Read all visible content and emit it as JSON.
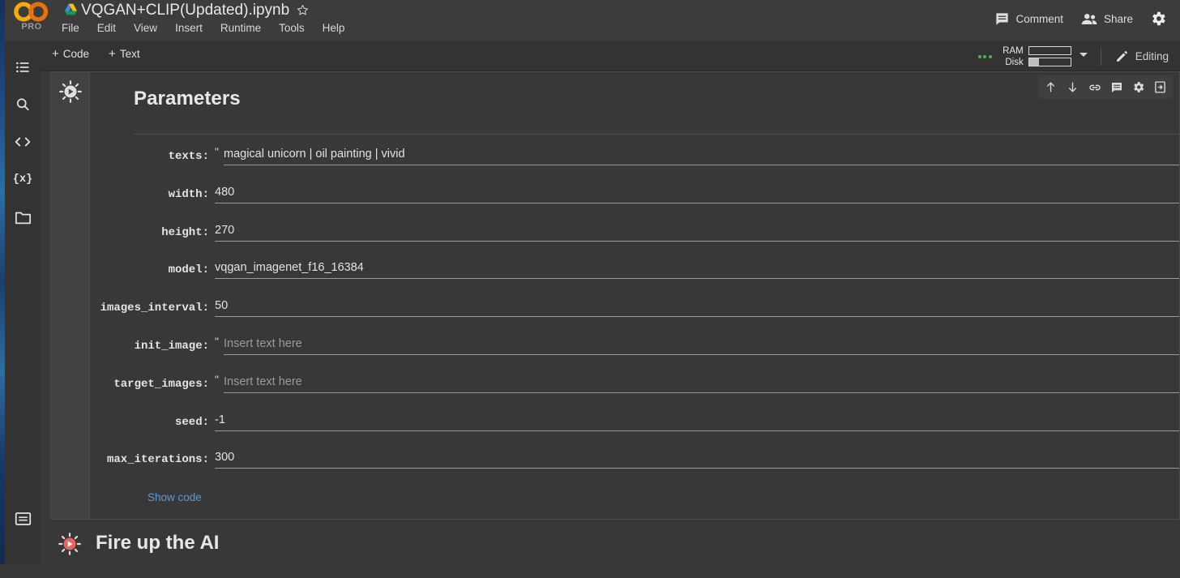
{
  "app": {
    "logo_text": "CO",
    "pro_badge": "PRO",
    "doc_title": "VQGAN+CLIP(Updated).ipynb"
  },
  "menubar": {
    "items": [
      {
        "label": "File"
      },
      {
        "label": "Edit"
      },
      {
        "label": "View"
      },
      {
        "label": "Insert"
      },
      {
        "label": "Runtime"
      },
      {
        "label": "Tools"
      },
      {
        "label": "Help"
      }
    ],
    "comment_label": "Comment",
    "share_label": "Share"
  },
  "toolbar": {
    "add_code_label": "Code",
    "add_text_label": "Text",
    "plus_sign": "+",
    "ram_label": "RAM",
    "disk_label": "Disk",
    "ram_fill_percent": 0,
    "disk_fill_percent": 25,
    "editing_label": "Editing"
  },
  "sidebar": {
    "items": [
      {
        "name": "table-of-contents",
        "icon": "list-icon"
      },
      {
        "name": "find-and-replace",
        "icon": "search-icon"
      },
      {
        "name": "code-snippets",
        "icon": "code-brackets-icon"
      },
      {
        "name": "variables",
        "icon": "variables-icon",
        "glyph": "{x}"
      },
      {
        "name": "files",
        "icon": "folder-icon"
      }
    ],
    "bottom_item": {
      "name": "terminal",
      "icon": "terminal-icon"
    }
  },
  "cell": {
    "form_title": "Parameters",
    "show_code_label": "Show code",
    "toolbar_icons": [
      "move-cell-up-icon",
      "move-cell-down-icon",
      "link-to-cell-icon",
      "add-comment-icon",
      "cell-settings-icon",
      "mirror-cell-icon"
    ],
    "fields": [
      {
        "label": "texts:",
        "value": "magical unicorn | oil painting | vivid",
        "quoted": true,
        "placeholder": false
      },
      {
        "label": "width:",
        "value": "480",
        "quoted": false,
        "placeholder": false
      },
      {
        "label": "height:",
        "value": "270",
        "quoted": false,
        "placeholder": false
      },
      {
        "label": "model:",
        "value": "vqgan_imagenet_f16_16384",
        "quoted": false,
        "placeholder": false
      },
      {
        "label": "images_interval:",
        "value": "50",
        "quoted": false,
        "placeholder": false
      },
      {
        "label": "init_image:",
        "value": "Insert text here",
        "quoted": true,
        "placeholder": true
      },
      {
        "label": "target_images:",
        "value": "Insert text here",
        "quoted": true,
        "placeholder": true
      },
      {
        "label": "seed:",
        "value": "-1",
        "quoted": false,
        "placeholder": false
      },
      {
        "label": "max_iterations:",
        "value": "300",
        "quoted": false,
        "placeholder": false
      }
    ]
  },
  "cell2": {
    "title": "Fire up the AI"
  },
  "colors": {
    "accent_blue": "#5b9bd5",
    "logo_orange": "#f9ab00",
    "run_red": "#e8675c",
    "status_green": "#4caf50",
    "page_bg": "#383838",
    "chrome_bg": "#333333"
  }
}
